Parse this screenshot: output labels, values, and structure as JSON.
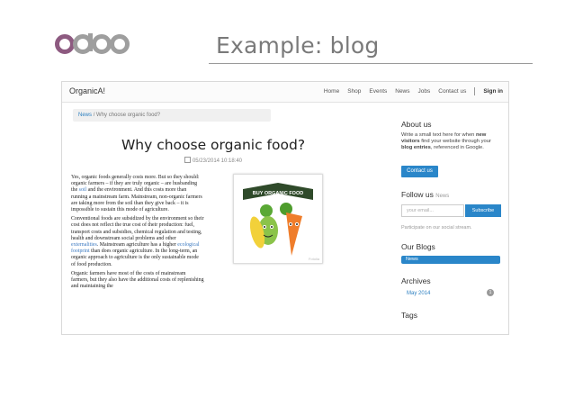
{
  "slide": {
    "logo_text": "odoo",
    "title": "Example: blog",
    "colors": {
      "logo_first_o": "#8d5a80",
      "logo_rest": "#9e9e9e",
      "accent_blue": "#2a86c9"
    }
  },
  "site": {
    "brand": "OrganicA!",
    "nav": [
      "Home",
      "Shop",
      "Events",
      "News",
      "Jobs",
      "Contact us"
    ],
    "sign_in": "Sign in"
  },
  "breadcrumb": {
    "section": "News",
    "separator": "/",
    "current": "Why choose organic food?"
  },
  "post": {
    "title": "Why choose organic food?",
    "date": "05/23/2014 10:18:40",
    "illustration_banner": "BUY ORGANIC FOOD",
    "illustration_watermark": "Fotolia",
    "p1": {
      "a": "Yes, organic foods generally costs more. But so they should: organic farmers – if they are truly organic – are husbanding the ",
      "link1": "soil",
      "b": " and the environment. And this costs more than running a mainstream farm. Mainstream, non-organic farmers are taking more from the soil than they give back – it is impossible to sustain this mode of agriculture."
    },
    "p2": {
      "a": "Conventional foods are subsidized by the environment so their cost does not reflect the true cost of their production: fuel, transport costs and subsidies, chemical regulation and testing, health and downstream social problems and other ",
      "link1": "externalities",
      "b": ". Mainstream agriculture has a higher ",
      "link2": "ecological footprint",
      "c": " than does organic agriculture. In the long-term, an organic approach to agriculture is the only sustainable mode of food production."
    },
    "p3": "Organic farmers have most of the costs of mainstream farmers, but they also have the additional costs of replenishing and maintaining the"
  },
  "sidebar": {
    "about_title": "About us",
    "about_text": {
      "a": "Write a small text here for when ",
      "bold1": "new visitors",
      "b": " find your website through your ",
      "bold2": "blog entries",
      "c": ", referenced in Google."
    },
    "contact_button": "Contact us",
    "follow_title": "Follow us",
    "follow_sub": "News",
    "email_placeholder": "your email...",
    "subscribe_button": "Subscribe",
    "participate_text": "Participate on our social stream.",
    "blogs_title": "Our Blogs",
    "blogs_item": "News",
    "archives_title": "Archives",
    "archives_month": "May 2014",
    "archives_count": "1",
    "tags_title": "Tags"
  }
}
